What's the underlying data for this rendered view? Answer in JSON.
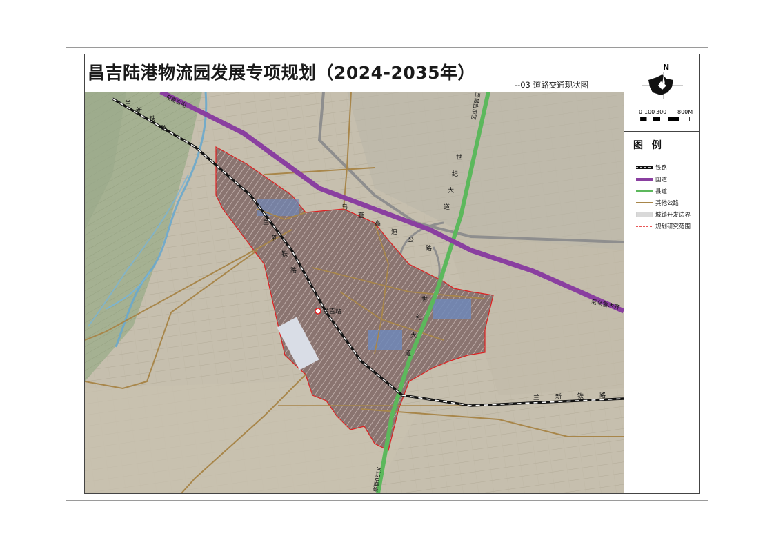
{
  "title": "昌吉陆港物流园发展专项规划（2024-2035年）",
  "subtitle": "--03 道路交通现状图",
  "north_label": "N",
  "scale": {
    "ticks": [
      "0",
      "100",
      "300",
      "800M"
    ]
  },
  "legend": {
    "title": "图 例",
    "items": [
      {
        "label": "铁路",
        "color": "#111111",
        "style": "railway"
      },
      {
        "label": "国道",
        "color": "#8a3fa0",
        "style": "solid"
      },
      {
        "label": "县道",
        "color": "#5cb85c",
        "style": "solid"
      },
      {
        "label": "其他公路",
        "color": "#a8864a",
        "style": "solid"
      },
      {
        "label": "城镇开发边界",
        "color": "#d9d9d9",
        "style": "fill"
      },
      {
        "label": "规划研究范围",
        "color": "#e02020",
        "style": "dashed"
      }
    ]
  },
  "map_labels": {
    "rail_north": [
      "兰",
      "新",
      "铁",
      "路"
    ],
    "rail_inner": [
      "兰",
      "新",
      "铁",
      "路"
    ],
    "rail_east": [
      "兰",
      "新",
      "铁",
      "路"
    ],
    "expressway": [
      "乌",
      "奎",
      "高",
      "速",
      "公",
      "路"
    ],
    "avenue_north": [
      "世",
      "纪",
      "大",
      "道"
    ],
    "avenue_south": [
      "世",
      "纪",
      "大",
      "道"
    ],
    "to_jiahu": "至嘉古屯",
    "to_urumqi": "至乌鲁木齐",
    "to_city": "至昌吉市区",
    "county_road": "X120县道",
    "station": "昌吉站"
  }
}
